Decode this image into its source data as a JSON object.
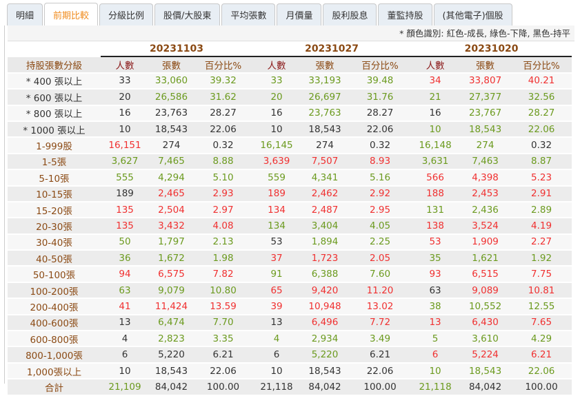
{
  "tabs": [
    "明細",
    "前期比較",
    "分級比例",
    "股價/大股東",
    "平均張數",
    "月價量",
    "股利股息",
    "董監持股",
    "(其他電子)個股"
  ],
  "active_tab": 1,
  "note": "* 顏色識別: 紅色-成長, 綠色-下降, 黑色-持平",
  "dates": [
    "20231103",
    "20231027",
    "20231020"
  ],
  "header": {
    "label": "持股張數分級",
    "cols": [
      "人數",
      "張數",
      "百分比%"
    ]
  },
  "colors": {
    "r": "#f03030",
    "g": "#6b9a1e",
    "k": "#333333",
    "label": "#8b4a14"
  },
  "rows": [
    {
      "label": "* 400 張以上",
      "star": true,
      "cells": [
        [
          "33",
          "k"
        ],
        [
          "33,060",
          "g"
        ],
        [
          "39.32",
          "g"
        ],
        [
          "33",
          "g"
        ],
        [
          "33,193",
          "g"
        ],
        [
          "39.48",
          "g"
        ],
        [
          "34",
          "r"
        ],
        [
          "33,807",
          "r"
        ],
        [
          "40.21",
          "r"
        ]
      ]
    },
    {
      "label": "* 600 張以上",
      "star": true,
      "cells": [
        [
          "20",
          "k"
        ],
        [
          "26,586",
          "g"
        ],
        [
          "31.62",
          "g"
        ],
        [
          "20",
          "g"
        ],
        [
          "26,697",
          "g"
        ],
        [
          "31.76",
          "g"
        ],
        [
          "21",
          "g"
        ],
        [
          "27,377",
          "g"
        ],
        [
          "32.56",
          "g"
        ]
      ]
    },
    {
      "label": "* 800 張以上",
      "star": true,
      "cells": [
        [
          "16",
          "k"
        ],
        [
          "23,763",
          "k"
        ],
        [
          "28.27",
          "k"
        ],
        [
          "16",
          "k"
        ],
        [
          "23,763",
          "g"
        ],
        [
          "28.27",
          "k"
        ],
        [
          "16",
          "k"
        ],
        [
          "23,767",
          "g"
        ],
        [
          "28.27",
          "g"
        ]
      ]
    },
    {
      "label": "* 1000 張以上",
      "star": true,
      "cells": [
        [
          "10",
          "k"
        ],
        [
          "18,543",
          "k"
        ],
        [
          "22.06",
          "k"
        ],
        [
          "10",
          "k"
        ],
        [
          "18,543",
          "k"
        ],
        [
          "22.06",
          "k"
        ],
        [
          "10",
          "g"
        ],
        [
          "18,543",
          "g"
        ],
        [
          "22.06",
          "g"
        ]
      ]
    },
    {
      "label": "1-999股",
      "cells": [
        [
          "16,151",
          "r"
        ],
        [
          "274",
          "k"
        ],
        [
          "0.32",
          "k"
        ],
        [
          "16,145",
          "g"
        ],
        [
          "274",
          "k"
        ],
        [
          "0.32",
          "k"
        ],
        [
          "16,148",
          "g"
        ],
        [
          "274",
          "g"
        ],
        [
          "0.32",
          "k"
        ]
      ]
    },
    {
      "label": "1-5張",
      "cells": [
        [
          "3,627",
          "g"
        ],
        [
          "7,465",
          "g"
        ],
        [
          "8.88",
          "g"
        ],
        [
          "3,639",
          "r"
        ],
        [
          "7,507",
          "r"
        ],
        [
          "8.93",
          "r"
        ],
        [
          "3,631",
          "g"
        ],
        [
          "7,463",
          "g"
        ],
        [
          "8.87",
          "g"
        ]
      ]
    },
    {
      "label": "5-10張",
      "cells": [
        [
          "555",
          "g"
        ],
        [
          "4,294",
          "g"
        ],
        [
          "5.10",
          "g"
        ],
        [
          "559",
          "g"
        ],
        [
          "4,341",
          "g"
        ],
        [
          "5.16",
          "g"
        ],
        [
          "566",
          "r"
        ],
        [
          "4,398",
          "r"
        ],
        [
          "5.23",
          "r"
        ]
      ]
    },
    {
      "label": "10-15張",
      "cells": [
        [
          "189",
          "k"
        ],
        [
          "2,465",
          "r"
        ],
        [
          "2.93",
          "r"
        ],
        [
          "189",
          "r"
        ],
        [
          "2,462",
          "r"
        ],
        [
          "2.92",
          "r"
        ],
        [
          "188",
          "r"
        ],
        [
          "2,453",
          "r"
        ],
        [
          "2.91",
          "r"
        ]
      ]
    },
    {
      "label": "15-20張",
      "cells": [
        [
          "135",
          "r"
        ],
        [
          "2,504",
          "r"
        ],
        [
          "2.97",
          "r"
        ],
        [
          "134",
          "r"
        ],
        [
          "2,487",
          "r"
        ],
        [
          "2.95",
          "r"
        ],
        [
          "131",
          "g"
        ],
        [
          "2,436",
          "g"
        ],
        [
          "2.89",
          "g"
        ]
      ]
    },
    {
      "label": "20-30張",
      "cells": [
        [
          "135",
          "r"
        ],
        [
          "3,432",
          "r"
        ],
        [
          "4.08",
          "r"
        ],
        [
          "134",
          "g"
        ],
        [
          "3,404",
          "g"
        ],
        [
          "4.05",
          "g"
        ],
        [
          "138",
          "r"
        ],
        [
          "3,524",
          "r"
        ],
        [
          "4.19",
          "r"
        ]
      ]
    },
    {
      "label": "30-40張",
      "cells": [
        [
          "50",
          "g"
        ],
        [
          "1,797",
          "g"
        ],
        [
          "2.13",
          "g"
        ],
        [
          "53",
          "k"
        ],
        [
          "1,894",
          "g"
        ],
        [
          "2.25",
          "g"
        ],
        [
          "53",
          "r"
        ],
        [
          "1,909",
          "r"
        ],
        [
          "2.27",
          "r"
        ]
      ]
    },
    {
      "label": "40-50張",
      "cells": [
        [
          "36",
          "g"
        ],
        [
          "1,672",
          "g"
        ],
        [
          "1.98",
          "g"
        ],
        [
          "37",
          "r"
        ],
        [
          "1,723",
          "r"
        ],
        [
          "2.05",
          "r"
        ],
        [
          "35",
          "g"
        ],
        [
          "1,621",
          "g"
        ],
        [
          "1.92",
          "g"
        ]
      ]
    },
    {
      "label": "50-100張",
      "cells": [
        [
          "94",
          "r"
        ],
        [
          "6,575",
          "r"
        ],
        [
          "7.82",
          "r"
        ],
        [
          "91",
          "g"
        ],
        [
          "6,388",
          "g"
        ],
        [
          "7.60",
          "g"
        ],
        [
          "93",
          "r"
        ],
        [
          "6,515",
          "r"
        ],
        [
          "7.75",
          "r"
        ]
      ]
    },
    {
      "label": "100-200張",
      "cells": [
        [
          "63",
          "g"
        ],
        [
          "9,079",
          "g"
        ],
        [
          "10.80",
          "g"
        ],
        [
          "65",
          "r"
        ],
        [
          "9,420",
          "r"
        ],
        [
          "11.20",
          "r"
        ],
        [
          "63",
          "k"
        ],
        [
          "9,089",
          "r"
        ],
        [
          "10.81",
          "r"
        ]
      ]
    },
    {
      "label": "200-400張",
      "cells": [
        [
          "41",
          "r"
        ],
        [
          "11,424",
          "r"
        ],
        [
          "13.59",
          "r"
        ],
        [
          "39",
          "r"
        ],
        [
          "10,948",
          "r"
        ],
        [
          "13.02",
          "r"
        ],
        [
          "38",
          "g"
        ],
        [
          "10,552",
          "g"
        ],
        [
          "12.55",
          "g"
        ]
      ]
    },
    {
      "label": "400-600張",
      "cells": [
        [
          "13",
          "k"
        ],
        [
          "6,474",
          "g"
        ],
        [
          "7.70",
          "g"
        ],
        [
          "13",
          "k"
        ],
        [
          "6,496",
          "r"
        ],
        [
          "7.72",
          "r"
        ],
        [
          "13",
          "r"
        ],
        [
          "6,430",
          "r"
        ],
        [
          "7.65",
          "r"
        ]
      ]
    },
    {
      "label": "600-800張",
      "cells": [
        [
          "4",
          "k"
        ],
        [
          "2,823",
          "g"
        ],
        [
          "3.35",
          "g"
        ],
        [
          "4",
          "g"
        ],
        [
          "2,934",
          "g"
        ],
        [
          "3.49",
          "g"
        ],
        [
          "5",
          "g"
        ],
        [
          "3,610",
          "g"
        ],
        [
          "4.29",
          "g"
        ]
      ]
    },
    {
      "label": "800-1,000張",
      "cells": [
        [
          "6",
          "k"
        ],
        [
          "5,220",
          "k"
        ],
        [
          "6.21",
          "k"
        ],
        [
          "6",
          "k"
        ],
        [
          "5,220",
          "g"
        ],
        [
          "6.21",
          "k"
        ],
        [
          "6",
          "r"
        ],
        [
          "5,224",
          "r"
        ],
        [
          "6.21",
          "r"
        ]
      ]
    },
    {
      "label": "1,000張以上",
      "cells": [
        [
          "10",
          "k"
        ],
        [
          "18,543",
          "k"
        ],
        [
          "22.06",
          "k"
        ],
        [
          "10",
          "k"
        ],
        [
          "18,543",
          "k"
        ],
        [
          "22.06",
          "k"
        ],
        [
          "10",
          "g"
        ],
        [
          "18,543",
          "g"
        ],
        [
          "22.06",
          "g"
        ]
      ]
    },
    {
      "label": "合計",
      "cells": [
        [
          "21,109",
          "g"
        ],
        [
          "84,042",
          "k"
        ],
        [
          "100.00",
          "k"
        ],
        [
          "21,118",
          "k"
        ],
        [
          "84,042",
          "k"
        ],
        [
          "100.00",
          "k"
        ],
        [
          "21,118",
          "g"
        ],
        [
          "84,042",
          "k"
        ],
        [
          "100.00",
          "k"
        ]
      ]
    }
  ]
}
